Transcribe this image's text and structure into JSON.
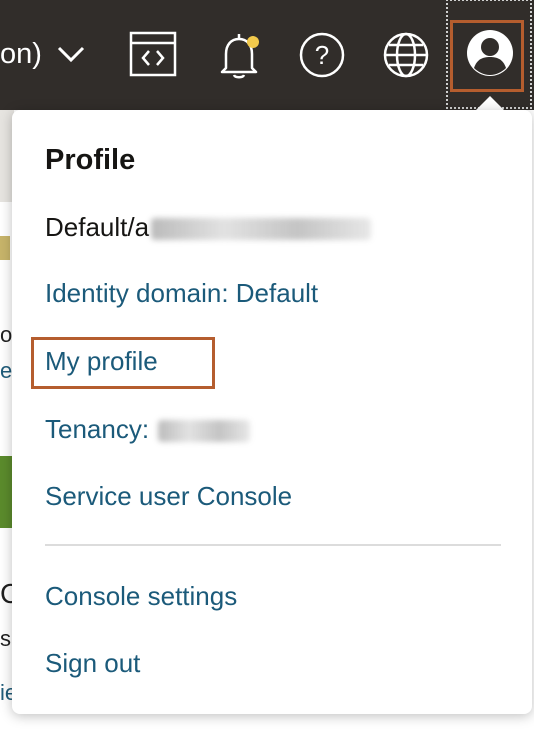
{
  "topbar": {
    "region_text": "on)",
    "icons": [
      "code-editor-icon",
      "bell-icon",
      "help-icon",
      "globe-icon",
      "user-profile-icon"
    ],
    "notification_dot_color": "#f2c94c"
  },
  "background": {
    "fragment_1": "o",
    "fragment_2": "e",
    "fragment_3": "C",
    "fragment_4": "s",
    "fragment_5": "ie"
  },
  "menu": {
    "title": "Profile",
    "user_line": "Default/a",
    "items": [
      {
        "label": "Identity domain: Default"
      },
      {
        "label": "My profile"
      },
      {
        "label": "Tenancy: "
      },
      {
        "label": "Service user Console"
      },
      {
        "label": "Console settings"
      },
      {
        "label": "Sign out"
      }
    ]
  },
  "colors": {
    "topbar": "#312d2a",
    "link": "#1b5a7a",
    "highlight": "#b55d2e"
  }
}
